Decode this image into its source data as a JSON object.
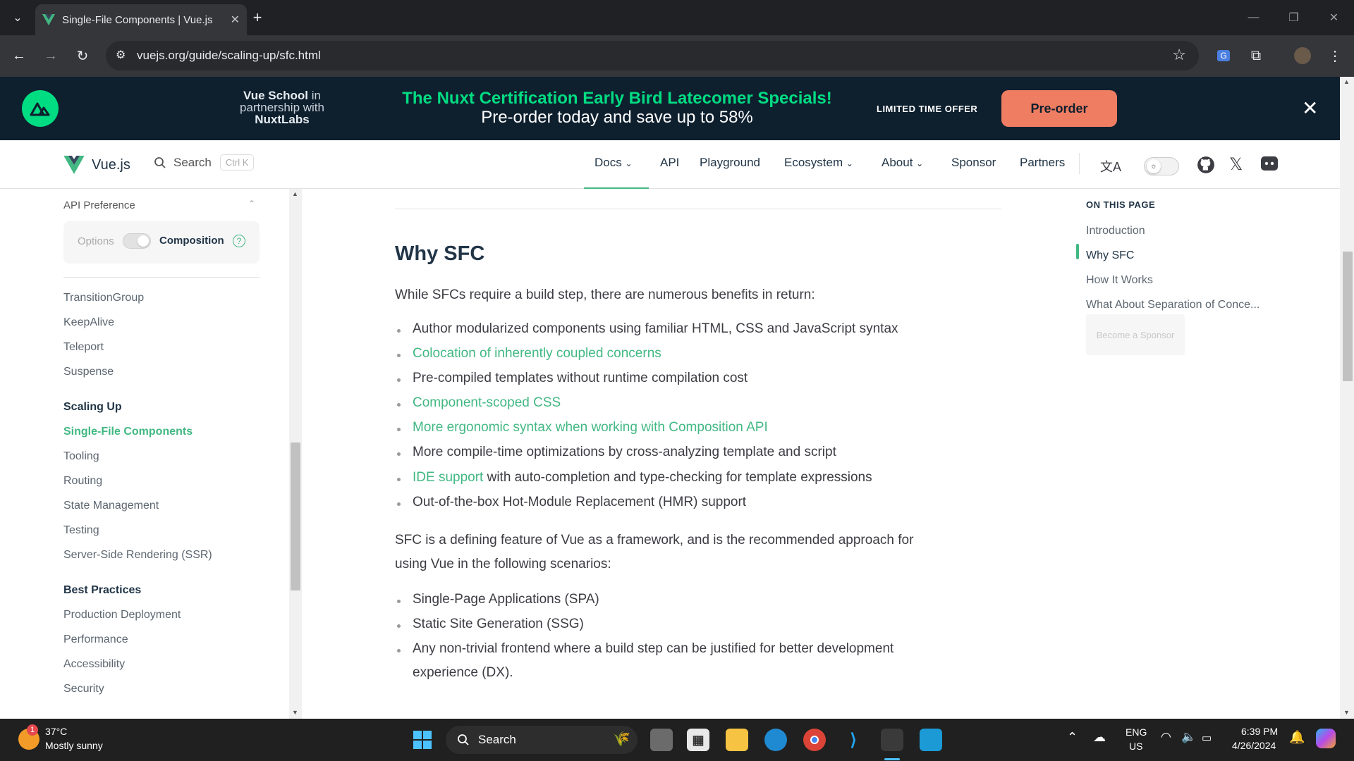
{
  "browser": {
    "tab_title": "Single-File Components | Vue.js",
    "url": "vuejs.org/guide/scaling-up/sfc.html"
  },
  "banner": {
    "partner_line1": "Vue School",
    "partner_line1_suffix": "in",
    "partner_line2": "partnership with",
    "partner_line3": "NuxtLabs",
    "headline": "The Nuxt Certification Early Bird Latecomer Specials!",
    "subline": "Pre-order today and save up to 58%",
    "offer": "LIMITED TIME OFFER",
    "button": "Pre-order"
  },
  "nav": {
    "brand": "Vue.js",
    "search_label": "Search",
    "search_shortcut": "Ctrl K",
    "items": [
      "Docs",
      "API",
      "Playground",
      "Ecosystem",
      "About",
      "Sponsor",
      "Partners"
    ]
  },
  "sidebar": {
    "api_preference": "API Preference",
    "opt_options": "Options",
    "opt_composition": "Composition",
    "builtins": [
      "TransitionGroup",
      "KeepAlive",
      "Teleport",
      "Suspense"
    ],
    "scaling_title": "Scaling Up",
    "scaling_items": [
      "Single-File Components",
      "Tooling",
      "Routing",
      "State Management",
      "Testing",
      "Server-Side Rendering (SSR)"
    ],
    "best_title": "Best Practices",
    "best_items": [
      "Production Deployment",
      "Performance",
      "Accessibility",
      "Security"
    ]
  },
  "content": {
    "heading": "Why SFC",
    "intro": "While SFCs require a build step, there are numerous benefits in return:",
    "benefits": [
      "Author modularized components using familiar HTML, CSS and JavaScript syntax",
      "Colocation of inherently coupled concerns",
      "Pre-compiled templates without runtime compilation cost",
      "Component-scoped CSS",
      "More ergonomic syntax when working with Composition API",
      "More compile-time optimizations by cross-analyzing template and script",
      "IDE support",
      "Out-of-the-box Hot-Module Replacement (HMR) support"
    ],
    "ide_suffix": " with auto-completion and type-checking for template expressions",
    "scenario_intro_1": "SFC is a defining feature of Vue as a framework, and is the recommended approach for",
    "scenario_intro_2": "using Vue in the following scenarios:",
    "scenarios": [
      "Single-Page Applications (SPA)",
      "Static Site Generation (SSG)",
      "Any non-trivial frontend where a build step can be justified for better development"
    ],
    "scenario_wrap": "experience (DX)."
  },
  "toc": {
    "title": "ON THIS PAGE",
    "items": [
      "Introduction",
      "Why SFC",
      "How It Works",
      "What About Separation of Conce..."
    ],
    "sponsor": "Become a Sponsor"
  },
  "taskbar": {
    "weather_temp": "37°C",
    "weather_desc": "Mostly sunny",
    "weather_badge": "1",
    "search": "Search",
    "lang1": "ENG",
    "lang2": "US",
    "time": "6:39 PM",
    "date": "4/26/2024"
  },
  "colors": {
    "vue_green": "#42b883",
    "banner_bg": "#0e1f2e",
    "nuxt_green": "#00dc82",
    "preorder": "#ef7d62"
  }
}
